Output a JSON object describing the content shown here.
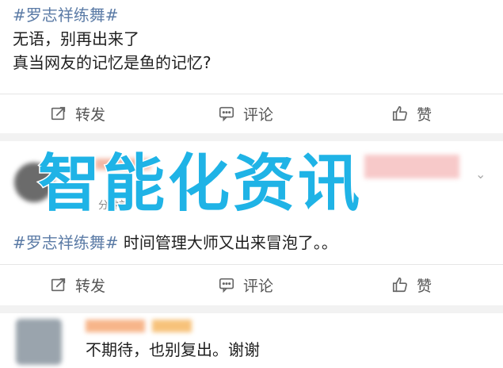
{
  "post1": {
    "hashtag": "#罗志祥练舞#",
    "line1": "无语，别再出来了",
    "line2": "真当网友的记忆是鱼的记忆?"
  },
  "actions": {
    "repost": "转发",
    "comment": "评论",
    "like": "赞"
  },
  "post2": {
    "time_partial": "分钟前",
    "hashtag": "#罗志祥练舞#",
    "text": "时间管理大师又出来冒泡了。。"
  },
  "comment": {
    "text": "不期待，也别复出。谢谢"
  },
  "watermark": "智能化资讯",
  "colors": {
    "link": "#5b7ba6",
    "watermark": "#1fb3e6"
  }
}
